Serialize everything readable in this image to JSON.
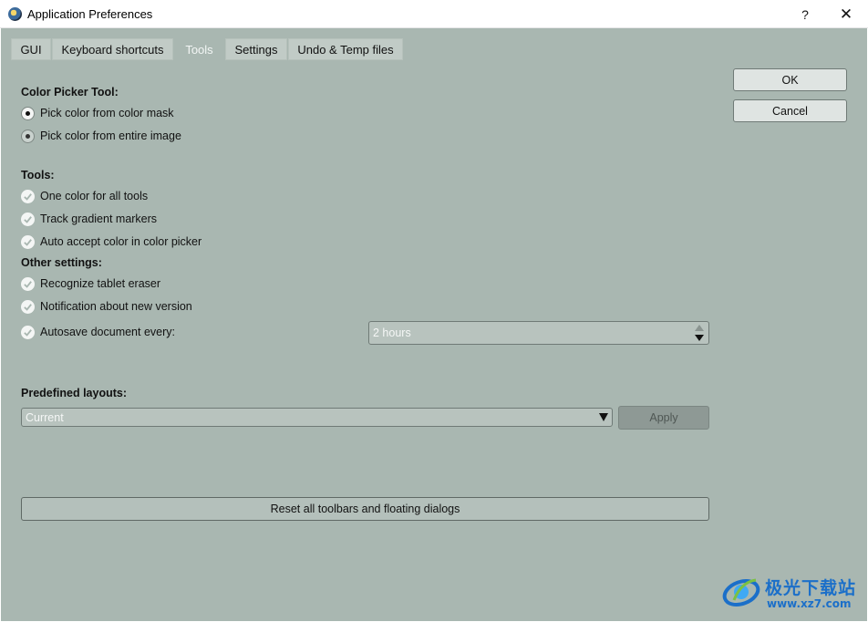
{
  "window": {
    "title": "Application Preferences",
    "help": "?",
    "close": "✕"
  },
  "tabs": [
    {
      "label": "GUI",
      "active": false
    },
    {
      "label": "Keyboard shortcuts",
      "active": false
    },
    {
      "label": "Tools",
      "active": true
    },
    {
      "label": "Settings",
      "active": false
    },
    {
      "label": "Undo & Temp files",
      "active": false
    }
  ],
  "color_picker": {
    "heading": "Color Picker Tool:",
    "options": [
      {
        "label": "Pick color from color mask",
        "selected": true
      },
      {
        "label": "Pick color from entire image",
        "selected": false
      }
    ]
  },
  "tools": {
    "heading": "Tools:",
    "items": [
      {
        "label": "One color for all tools",
        "checked": true
      },
      {
        "label": "Track gradient markers",
        "checked": true
      },
      {
        "label": "Auto accept color in color picker",
        "checked": true
      }
    ]
  },
  "other_settings": {
    "heading": "Other settings:",
    "items": [
      {
        "label": "Recognize tablet eraser",
        "checked": true
      },
      {
        "label": "Notification about new version",
        "checked": true
      },
      {
        "label": "Autosave document every:",
        "checked": true
      }
    ],
    "autosave_interval": "2 hours"
  },
  "layouts": {
    "heading": "Predefined layouts:",
    "selected": "Current",
    "apply_label": "Apply"
  },
  "reset_label": "Reset all toolbars and floating dialogs",
  "dialog_buttons": {
    "ok": "OK",
    "cancel": "Cancel"
  },
  "watermark": {
    "brand": "极光下载站",
    "url": "www.xz7.com"
  },
  "colors": {
    "panel_bg": "#a9b7b1",
    "tab_bg": "#c1cbc6",
    "watermark_blue": "#1b6fc9"
  }
}
